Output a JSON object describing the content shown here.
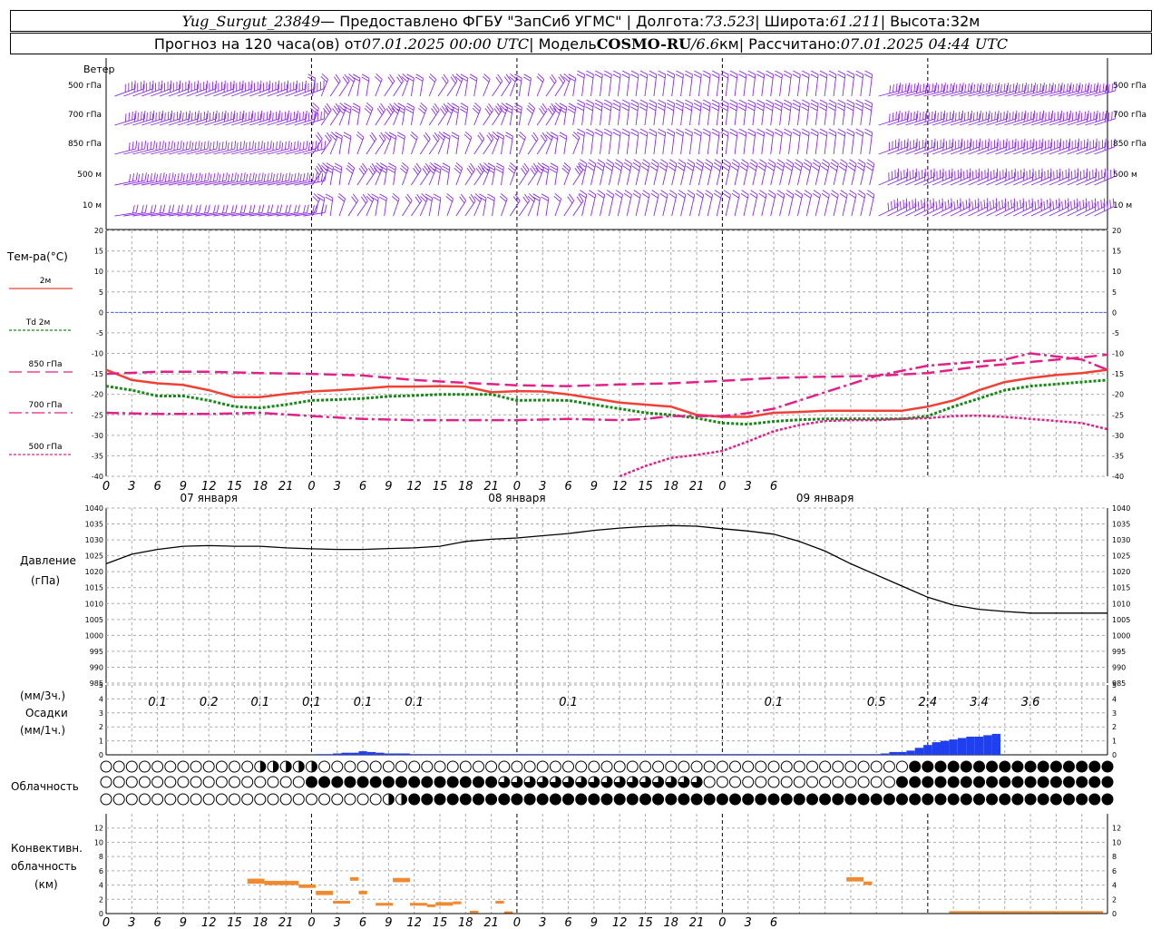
{
  "header": {
    "station": "Yug_Surgut_23849",
    "provider": " — Предоставлено ФГБУ \"ЗапСиб УГМС\" | Долгота: ",
    "lon": "73.523",
    "lat_label": " | Широта: ",
    "lat": "61.211",
    "alt_label": " | Высота: ",
    "alt": "32м",
    "forecast_prefix": "Прогноз на 120 часа(ов) от ",
    "forecast_from": "07.01.2025 00:00 UTC",
    "model_label": "  | Модель ",
    "model": "COSMO-RU",
    "resolution_prefix": " / ",
    "resolution": "6.6",
    "resolution_unit": "км",
    "calc_label": " | Рассчитано: ",
    "calc_time": "07.01.2025 04:44 UTC"
  },
  "wind": {
    "title": "Ветер",
    "levels": [
      "500 гПа",
      "700 гПа",
      "850 гПа",
      "500 м",
      "10  м"
    ]
  },
  "temp_panel": {
    "title": "Тем-ра(°C)",
    "legend": [
      "2м",
      "Td 2м",
      "850 гПа",
      "700 гПа",
      "500 гПа"
    ],
    "day_labels": [
      "07 января",
      "08 января",
      "09 января"
    ]
  },
  "pressure_panel": {
    "title": "Давление",
    "unit": "(гПа)"
  },
  "precip_panel": {
    "unit3": "(мм/3ч.)",
    "title": "Осадки",
    "unit1": "(мм/1ч.)",
    "totals": [
      {
        "h": 6,
        "v": "0.1"
      },
      {
        "h": 12,
        "v": "0.2"
      },
      {
        "h": 18,
        "v": "0.1"
      },
      {
        "h": 24,
        "v": "0.1"
      },
      {
        "h": 30,
        "v": "0.1"
      },
      {
        "h": 36,
        "v": "0.1"
      },
      {
        "h": 54,
        "v": "0.1"
      },
      {
        "h": 78,
        "v": "0.1"
      },
      {
        "h": 90,
        "v": "0.5"
      },
      {
        "h": 96,
        "v": "2.4"
      },
      {
        "h": 102,
        "v": "3.4"
      },
      {
        "h": 108,
        "v": "3.6"
      }
    ]
  },
  "cloud_panel": {
    "title": "Облачность"
  },
  "conv_panel": {
    "title_lines": [
      "Конвективн.",
      "облачность",
      "(км)"
    ]
  },
  "colors": {
    "wind": "#8a2be2",
    "t2m": "#ef4136",
    "td2m": "#168a16",
    "t850": "#e0218a",
    "t700": "#e0218a",
    "t500": "#e0218a",
    "precip": "#2040f0",
    "conv": "#f08a30",
    "zero_line": "#4060ff"
  },
  "chart_data": [
    {
      "type": "line",
      "title": "Тем-ра(°C)",
      "x_unit": "hours from 07.01.2025 00:00 UTC",
      "xlim": [
        0,
        117
      ],
      "ylim": [
        -40,
        20
      ],
      "x_ticks": [
        0,
        3,
        6,
        9,
        12,
        15,
        18,
        21,
        0,
        3,
        6,
        9,
        12,
        15,
        18,
        21,
        0,
        3,
        6,
        9,
        12,
        15,
        18,
        21,
        0,
        3,
        6
      ],
      "y_ticks": [
        -40,
        -35,
        -30,
        -25,
        -20,
        -15,
        -10,
        -5,
        0,
        5,
        10,
        15,
        20
      ],
      "series": [
        {
          "name": "2м",
          "x": [
            0,
            3,
            6,
            9,
            12,
            15,
            18,
            21,
            24,
            27,
            30,
            33,
            36,
            39,
            42,
            45,
            48,
            51,
            54,
            57,
            60,
            63,
            66,
            69,
            72,
            75,
            78,
            81,
            84,
            87,
            90,
            93,
            96,
            99,
            102,
            105,
            108,
            111,
            114,
            117
          ],
          "y": [
            -14,
            -16.5,
            -17.3,
            -17.7,
            -19,
            -20.7,
            -20.7,
            -19.9,
            -19.3,
            -19,
            -18.6,
            -18.1,
            -18.1,
            -18,
            -18.1,
            -19.5,
            -19.2,
            -19.3,
            -20,
            -21,
            -22,
            -22.5,
            -23,
            -25,
            -25.5,
            -25.5,
            -24.5,
            -24.3,
            -24,
            -24,
            -24,
            -24,
            -23,
            -21.5,
            -19,
            -17,
            -16,
            -15.3,
            -14.8,
            -14
          ]
        },
        {
          "name": "Td 2м",
          "x": [
            0,
            3,
            6,
            9,
            12,
            15,
            18,
            21,
            24,
            27,
            30,
            33,
            36,
            39,
            42,
            45,
            48,
            51,
            54,
            57,
            60,
            63,
            66,
            69,
            72,
            75,
            78,
            81,
            84,
            87,
            90,
            93,
            96,
            99,
            102,
            105,
            108,
            111,
            114,
            117
          ],
          "y": [
            -18,
            -19,
            -20.4,
            -20.4,
            -21.5,
            -23,
            -23.3,
            -22.5,
            -21.5,
            -21.3,
            -21,
            -20.5,
            -20.3,
            -20,
            -20,
            -20,
            -21.5,
            -21.4,
            -21.5,
            -22.5,
            -23.5,
            -24.5,
            -25,
            -25.8,
            -27,
            -27.3,
            -26.6,
            -26.2,
            -26,
            -26,
            -26,
            -26,
            -25.3,
            -23,
            -21,
            -19,
            -18,
            -17.5,
            -17,
            -16.5
          ]
        },
        {
          "name": "850 гПа",
          "x": [
            0,
            6,
            12,
            18,
            24,
            30,
            36,
            42,
            48,
            54,
            60,
            66,
            72,
            78,
            84,
            90,
            96,
            102,
            108,
            114,
            117
          ],
          "y": [
            -15,
            -14.5,
            -14.5,
            -14.8,
            -15,
            -15.4,
            -16.5,
            -17.2,
            -17.8,
            -18,
            -17.6,
            -17.3,
            -16.7,
            -16,
            -15.7,
            -15.5,
            -14.8,
            -13.2,
            -12.1,
            -11,
            -10.3
          ]
        },
        {
          "name": "700 гПа",
          "x": [
            0,
            6,
            12,
            18,
            24,
            30,
            36,
            42,
            48,
            54,
            60,
            63,
            66,
            69,
            72,
            75,
            78,
            84,
            90,
            96,
            102,
            105,
            108,
            114,
            117
          ],
          "y": [
            -24.5,
            -24.8,
            -24.8,
            -24.5,
            -25.3,
            -26,
            -26.3,
            -26.3,
            -26.3,
            -26,
            -26.3,
            -26,
            -25.3,
            -25.3,
            -25.3,
            -24.6,
            -23.5,
            -19.5,
            -15.5,
            -13,
            -12,
            -11.5,
            -10,
            -11.5,
            -14
          ]
        },
        {
          "name": "500 гПа",
          "x": [
            60,
            63,
            66,
            69,
            72,
            75,
            78,
            81,
            84,
            87,
            90,
            93,
            96,
            99,
            102,
            105,
            108,
            111,
            114,
            117
          ],
          "y": [
            -40,
            -37.5,
            -35.5,
            -34.8,
            -33.8,
            -31.5,
            -29,
            -27.5,
            -26.5,
            -26.3,
            -26.3,
            -26,
            -25.8,
            -25.3,
            -25.2,
            -25.5,
            -26,
            -26.5,
            -27,
            -28.5
          ]
        }
      ]
    },
    {
      "type": "line",
      "title": "Давление",
      "ylabel": "(гПа)",
      "xlim": [
        0,
        117
      ],
      "ylim": [
        985,
        1040
      ],
      "y_ticks": [
        985,
        990,
        995,
        1000,
        1005,
        1010,
        1015,
        1020,
        1025,
        1030,
        1035,
        1040
      ],
      "series": [
        {
          "name": "Давление",
          "x": [
            0,
            3,
            6,
            9,
            12,
            15,
            18,
            21,
            24,
            27,
            30,
            33,
            36,
            39,
            42,
            45,
            48,
            51,
            54,
            57,
            60,
            63,
            66,
            69,
            72,
            75,
            78,
            81,
            84,
            87,
            90,
            93,
            96,
            99,
            102,
            105,
            108,
            111,
            114,
            117
          ],
          "y": [
            1022.5,
            1025.5,
            1027,
            1028,
            1028.2,
            1028,
            1028,
            1027.5,
            1027.2,
            1027,
            1027,
            1027.3,
            1027.5,
            1028,
            1029.5,
            1030.2,
            1030.6,
            1031.3,
            1032,
            1033,
            1033.7,
            1034.2,
            1034.5,
            1034.3,
            1033.5,
            1032.8,
            1031.8,
            1029.5,
            1026.5,
            1022.5,
            1019,
            1015.5,
            1012,
            1009.5,
            1008.2,
            1007.5,
            1007,
            1007,
            1007,
            1007
          ]
        }
      ]
    },
    {
      "type": "bar",
      "title": "Осадки",
      "ylabel": "(мм/1ч.)",
      "ylim": [
        0,
        5
      ],
      "y_ticks": [
        0,
        1,
        2,
        3,
        4,
        5
      ],
      "x": [
        25,
        26,
        27,
        28,
        29,
        30,
        31,
        32,
        33,
        34,
        35,
        36,
        37,
        38,
        39,
        40,
        41,
        42,
        43,
        44,
        45,
        46,
        47,
        48,
        49,
        50,
        51,
        52,
        53,
        54,
        55,
        56,
        57,
        58,
        59,
        60,
        61,
        62,
        63,
        64,
        65,
        66,
        67,
        68,
        69,
        70,
        71,
        72,
        73,
        74,
        75,
        76,
        77,
        78,
        79,
        80,
        81,
        82,
        83,
        84,
        85,
        86,
        87,
        88,
        89,
        90,
        91,
        92,
        93,
        94,
        95,
        96,
        97,
        98,
        99,
        100,
        101,
        102,
        103,
        104
      ],
      "values": [
        0.05,
        0.05,
        0.1,
        0.15,
        0.15,
        0.25,
        0.2,
        0.15,
        0.1,
        0.1,
        0.1,
        0.05,
        0.05,
        0.05,
        0.05,
        0.05,
        0.05,
        0.05,
        0.05,
        0.05,
        0.05,
        0.05,
        0.05,
        0.05,
        0.05,
        0.05,
        0.05,
        0.05,
        0.05,
        0.05,
        0.05,
        0.05,
        0.05,
        0.05,
        0.05,
        0.05,
        0.05,
        0.05,
        0.05,
        0.05,
        0.05,
        0.05,
        0.05,
        0.05,
        0.05,
        0.05,
        0.05,
        0.05,
        0.05,
        0.05,
        0.05,
        0.05,
        0.05,
        0.05,
        0.05,
        0.05,
        0.05,
        0.05,
        0.05,
        0.05,
        0.05,
        0.05,
        0.05,
        0.05,
        0.05,
        0.05,
        0.1,
        0.2,
        0.2,
        0.3,
        0.5,
        0.7,
        0.9,
        1.0,
        1.1,
        1.2,
        1.3,
        1.3,
        1.4,
        1.5,
        1.6,
        0.9
      ]
    },
    {
      "type": "bar",
      "title": "Конвективн. облачность",
      "ylabel": "(км)",
      "ylim": [
        0,
        14
      ],
      "y_ticks": [
        0,
        2,
        4,
        6,
        8,
        10,
        12
      ],
      "segments": [
        {
          "x0": 16.5,
          "x1": 18.5,
          "lo": 4.2,
          "hi": 4.9
        },
        {
          "x0": 18.5,
          "x1": 22.5,
          "lo": 4.0,
          "hi": 4.6
        },
        {
          "x0": 22.5,
          "x1": 24.5,
          "lo": 3.6,
          "hi": 4.1
        },
        {
          "x0": 24.5,
          "x1": 26.5,
          "lo": 2.6,
          "hi": 3.2
        },
        {
          "x0": 26.5,
          "x1": 28.5,
          "lo": 1.4,
          "hi": 1.8
        },
        {
          "x0": 28.5,
          "x1": 29.5,
          "lo": 4.6,
          "hi": 5.1
        },
        {
          "x0": 29.5,
          "x1": 30.5,
          "lo": 2.7,
          "hi": 3.2
        },
        {
          "x0": 31.5,
          "x1": 33.5,
          "lo": 1.1,
          "hi": 1.5
        },
        {
          "x0": 33.5,
          "x1": 35.5,
          "lo": 4.4,
          "hi": 5.0
        },
        {
          "x0": 35.5,
          "x1": 37.5,
          "lo": 1.1,
          "hi": 1.5
        },
        {
          "x0": 37.5,
          "x1": 38.5,
          "lo": 0.9,
          "hi": 1.3
        },
        {
          "x0": 38.5,
          "x1": 40.5,
          "lo": 1.1,
          "hi": 1.6
        },
        {
          "x0": 40.5,
          "x1": 41.5,
          "lo": 1.3,
          "hi": 1.7
        },
        {
          "x0": 42.5,
          "x1": 43.5,
          "lo": 0.1,
          "hi": 0.4
        },
        {
          "x0": 45.5,
          "x1": 46.5,
          "lo": 1.4,
          "hi": 1.8
        },
        {
          "x0": 46.5,
          "x1": 47.5,
          "lo": 0.1,
          "hi": 0.3
        },
        {
          "x0": 86.5,
          "x1": 88.5,
          "lo": 4.5,
          "hi": 5.1
        },
        {
          "x0": 88.5,
          "x1": 89.5,
          "lo": 4.0,
          "hi": 4.5
        },
        {
          "x0": 98.5,
          "x1": 116.5,
          "lo": 0.15,
          "hi": 0.35
        }
      ]
    }
  ]
}
